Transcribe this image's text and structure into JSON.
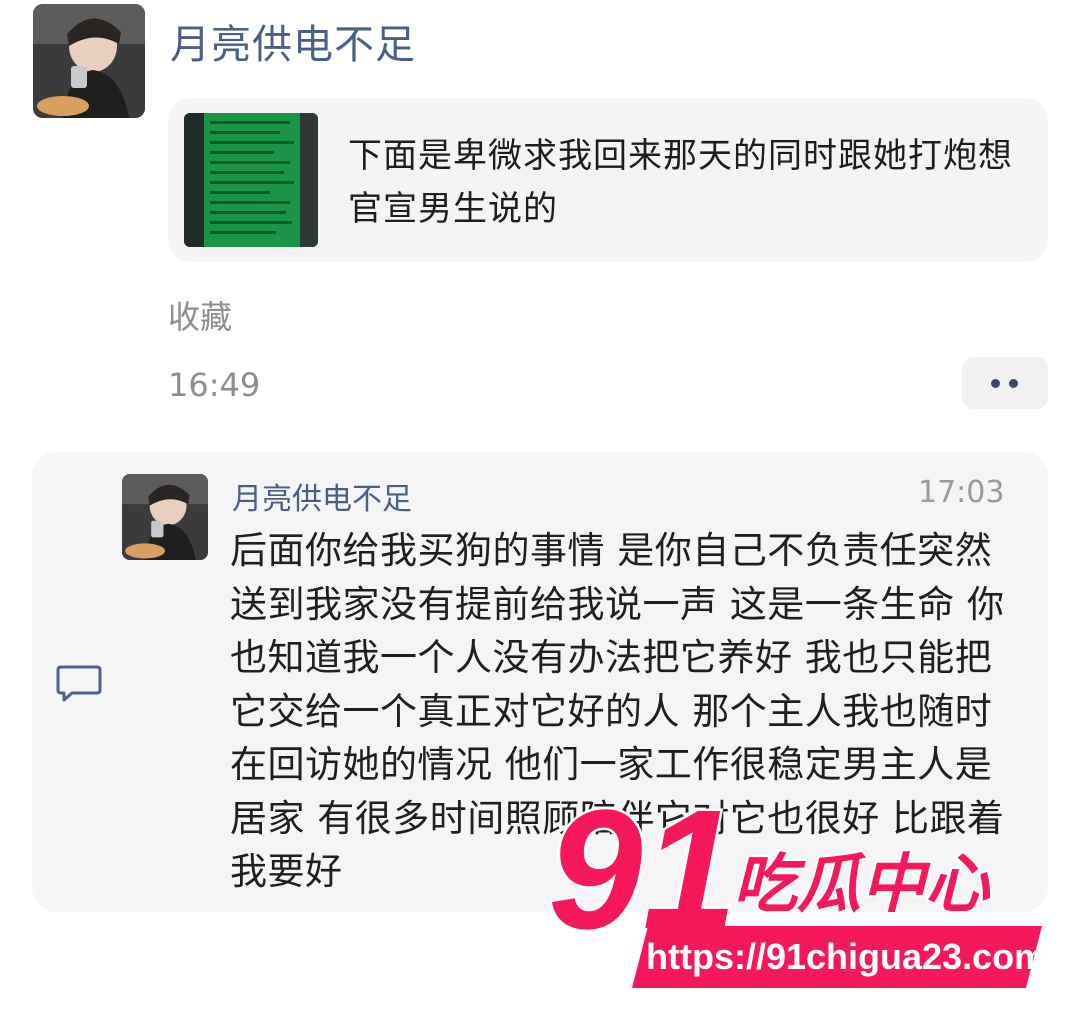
{
  "message": {
    "sender_name": "月亮供电不足",
    "card_text": "下面是卑微求我回来那天的同时跟她打炮想官宣男生说的",
    "card_thumb_icon": "chat-log-screenshot-thumbnail",
    "source_label": "收藏",
    "time": "16:49",
    "more_icon": "more-dots-icon"
  },
  "quote": {
    "sender_name": "月亮供电不足",
    "time": "17:03",
    "text": "后面你给我买狗的事情 是你自己不负责任突然送到我家没有提前给我说一声 这是一条生命 你也知道我一个人没有办法把它养好 我也只能把它交给一个真正对它好的人 那个主人我也随时在回访她的情况 他们一家工作很稳定男主人是居家 有很多时间照顾陪伴它对它也很好 比跟着我要好",
    "icon": "comment-icon"
  },
  "watermark": {
    "number": "91",
    "title": "吃瓜中心",
    "url": "https://91chigua23.com",
    "color": "#f5185a"
  }
}
